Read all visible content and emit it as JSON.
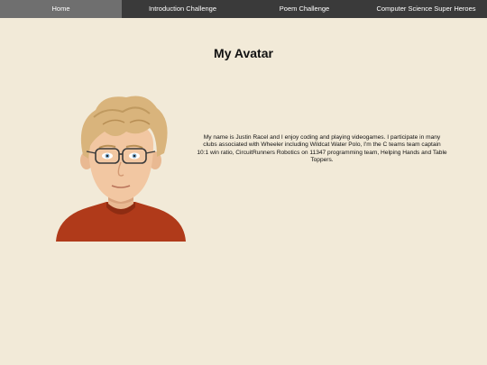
{
  "nav": {
    "items": [
      {
        "label": "Home"
      },
      {
        "label": "Introduction Challenge"
      },
      {
        "label": "Poem Challenge"
      },
      {
        "label": "Computer Science Super Heroes"
      }
    ],
    "active_index": 0
  },
  "main": {
    "title": "My Avatar",
    "bio": "My name is Justin Racel and I enjoy coding and playing videogames. I participate in many clubs associated with Wheeler including Wildcat Water Polo, I'm the C teams team captain 10:1 win ratio, CircuitRunners Robotics on 11347 programming team, Helping Hands and Table Toppers."
  },
  "colors": {
    "background": "#f2ead8",
    "nav_bg": "#3a3a3a",
    "nav_active": "#6f6f6f",
    "shirt": "#b03a1a"
  },
  "icons": {
    "avatar": "cartoon-avatar-with-glasses"
  }
}
